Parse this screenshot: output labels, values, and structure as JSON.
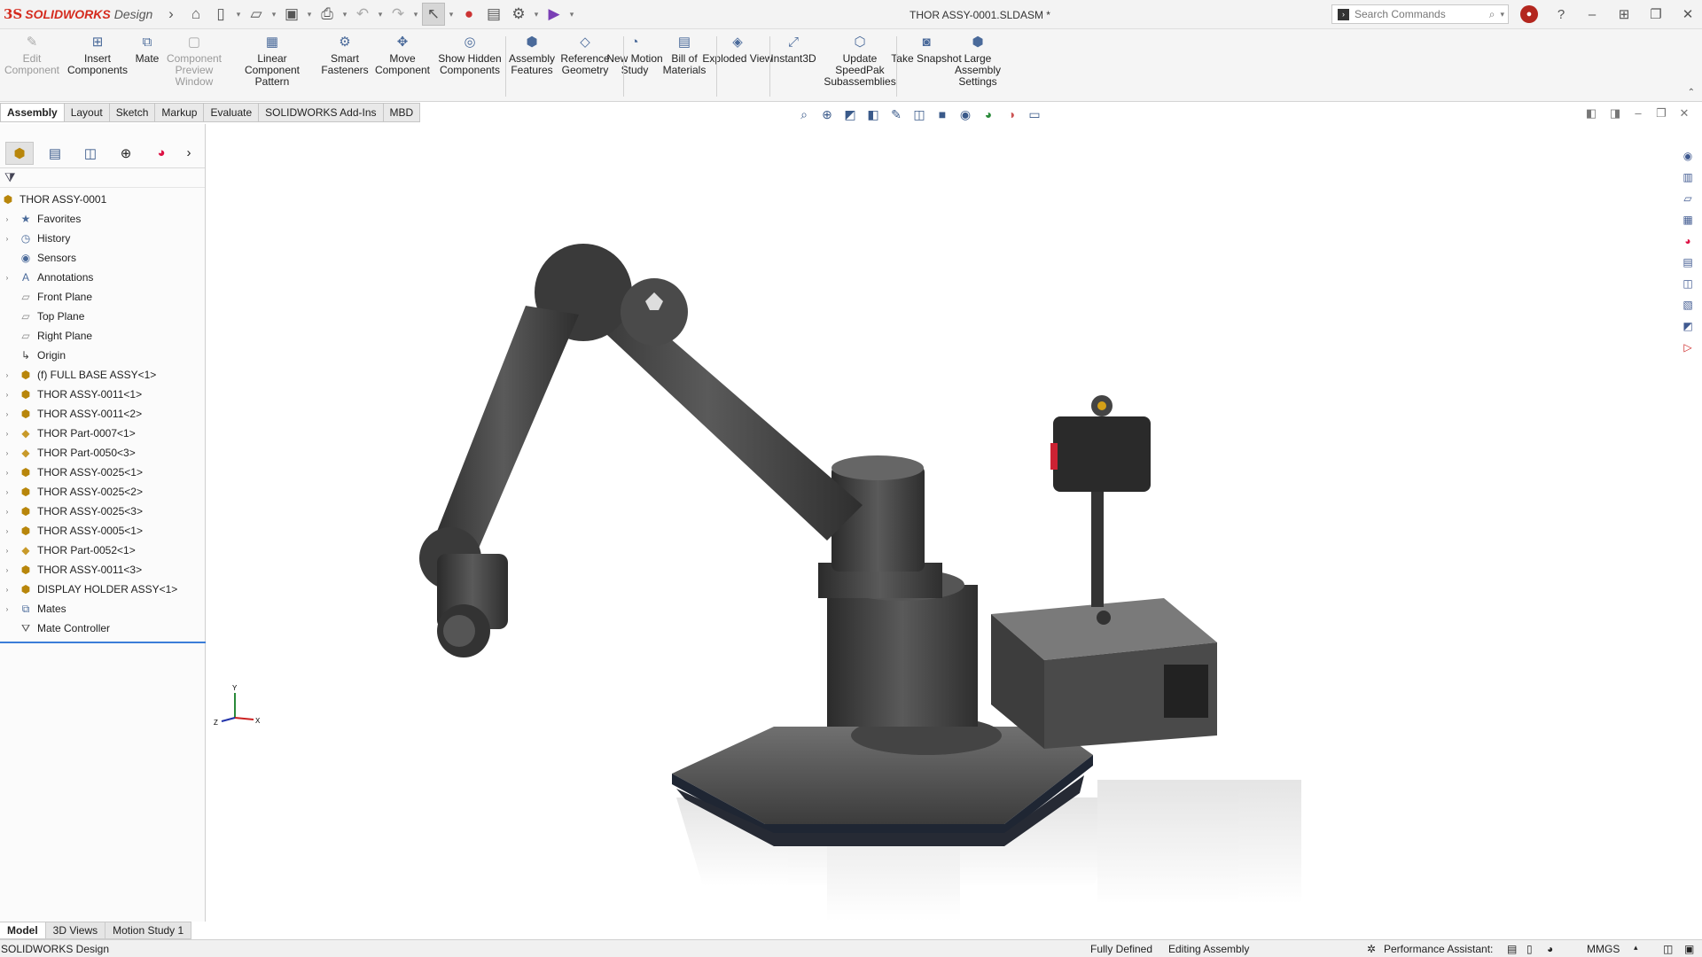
{
  "app": {
    "brand_ds": "3S",
    "brand_name": "SOLIDWORKS",
    "brand_suffix": "Design",
    "document_title": "THOR ASSY-0001.SLDASM *"
  },
  "search": {
    "placeholder": "Search Commands"
  },
  "ribbon": [
    {
      "label": "Edit Component",
      "icon": "edit-component-icon",
      "disabled": true
    },
    {
      "label": "Insert Components",
      "icon": "insert-components-icon"
    },
    {
      "label": "Mate",
      "icon": "mate-icon"
    },
    {
      "label": "Component Preview Window",
      "icon": "component-preview-icon",
      "disabled": true
    },
    {
      "label": "Linear Component Pattern",
      "icon": "linear-pattern-icon"
    },
    {
      "label": "Smart Fasteners",
      "icon": "smart-fasteners-icon"
    },
    {
      "label": "Move Component",
      "icon": "move-component-icon"
    },
    {
      "label": "Show Hidden Components",
      "icon": "show-hidden-icon"
    },
    {
      "label": "Assembly Features",
      "icon": "assembly-features-icon"
    },
    {
      "label": "Reference Geometry",
      "icon": "reference-geometry-icon"
    },
    {
      "label": "New Motion Study",
      "icon": "motion-study-icon"
    },
    {
      "label": "Bill of Materials",
      "icon": "bom-icon"
    },
    {
      "label": "Exploded View",
      "icon": "exploded-view-icon"
    },
    {
      "label": "Instant3D",
      "icon": "instant3d-icon"
    },
    {
      "label": "Update SpeedPak Subassemblies",
      "icon": "speedpak-icon"
    },
    {
      "label": "Take Snapshot",
      "icon": "snapshot-icon"
    },
    {
      "label": "Large Assembly Settings",
      "icon": "large-assembly-icon"
    }
  ],
  "tabs": [
    "Assembly",
    "Layout",
    "Sketch",
    "Markup",
    "Evaluate",
    "SOLIDWORKS Add-Ins",
    "MBD"
  ],
  "tree": [
    {
      "label": "THOR ASSY-0001",
      "icon": "assembly-icon",
      "expand": false,
      "root": true
    },
    {
      "label": "Favorites",
      "icon": "favorites-icon",
      "expand": true
    },
    {
      "label": "History",
      "icon": "history-icon",
      "expand": true
    },
    {
      "label": "Sensors",
      "icon": "sensors-icon",
      "expand": false
    },
    {
      "label": "Annotations",
      "icon": "annotations-icon",
      "expand": true
    },
    {
      "label": "Front Plane",
      "icon": "plane-icon",
      "expand": false
    },
    {
      "label": "Top Plane",
      "icon": "plane-icon",
      "expand": false
    },
    {
      "label": "Right Plane",
      "icon": "plane-icon",
      "expand": false
    },
    {
      "label": "Origin",
      "icon": "origin-icon",
      "expand": false
    },
    {
      "label": "(f) FULL BASE ASSY<1>",
      "icon": "subassembly-icon",
      "expand": true
    },
    {
      "label": "THOR ASSY-0011<1>",
      "icon": "subassembly-icon",
      "expand": true
    },
    {
      "label": "THOR ASSY-0011<2>",
      "icon": "subassembly-icon",
      "expand": true
    },
    {
      "label": "THOR Part-0007<1>",
      "icon": "part-icon",
      "expand": true
    },
    {
      "label": "THOR Part-0050<3>",
      "icon": "part-icon",
      "expand": true
    },
    {
      "label": "THOR ASSY-0025<1>",
      "icon": "subassembly-icon",
      "expand": true
    },
    {
      "label": "THOR ASSY-0025<2>",
      "icon": "subassembly-icon",
      "expand": true
    },
    {
      "label": "THOR ASSY-0025<3>",
      "icon": "subassembly-icon",
      "expand": true
    },
    {
      "label": "THOR ASSY-0005<1>",
      "icon": "subassembly-icon",
      "expand": true
    },
    {
      "label": "THOR Part-0052<1>",
      "icon": "part-icon",
      "expand": true
    },
    {
      "label": "THOR ASSY-0011<3>",
      "icon": "subassembly-icon",
      "expand": true
    },
    {
      "label": "DISPLAY HOLDER ASSY<1>",
      "icon": "subassembly-icon",
      "expand": true
    },
    {
      "label": "Mates",
      "icon": "mates-icon",
      "expand": true
    },
    {
      "label": "Mate Controller",
      "icon": "mate-controller-icon",
      "expand": false
    }
  ],
  "bottom_tabs": [
    "Model",
    "3D Views",
    "Motion Study 1"
  ],
  "status": {
    "left": "SOLIDWORKS Design",
    "defined": "Fully Defined",
    "mode": "Editing Assembly",
    "assistant": "Performance Assistant:",
    "units": "MMGS"
  },
  "triad": {
    "y": "Y",
    "x": "X",
    "z": "Z"
  }
}
